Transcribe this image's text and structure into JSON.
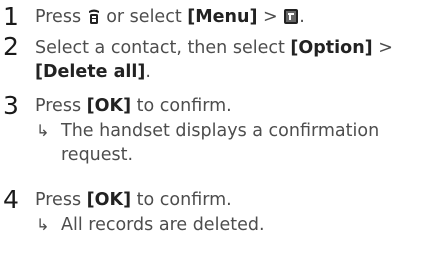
{
  "steps": [
    {
      "number": "1",
      "line1": {
        "prefix": "Press",
        "key_icon": "phonebook-key-icon",
        "middle": "or select",
        "menu_label": "[Menu]",
        "separator": ">",
        "menu_icon": "phonebook-menu-icon",
        "suffix": "."
      }
    },
    {
      "number": "2",
      "line1": {
        "prefix": "Select a contact, then select",
        "option_label": "[Option]",
        "suffix": ">"
      },
      "line2": {
        "delete_label": "[Delete all]",
        "suffix": "."
      }
    },
    {
      "number": "3",
      "line1": {
        "prefix": "Press",
        "ok_label": "[OK]",
        "suffix": "to confirm."
      },
      "result": {
        "arrow": "↳",
        "line1": "The handset displays a confirmation",
        "line2": "request."
      }
    },
    {
      "number": "4",
      "line1": {
        "prefix": "Press",
        "ok_label": "[OK]",
        "suffix": "to confirm."
      },
      "result": {
        "arrow": "↳",
        "line1": "All records are deleted."
      }
    }
  ]
}
